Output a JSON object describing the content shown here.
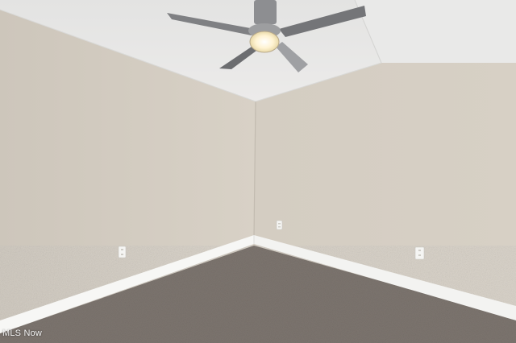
{
  "watermark": {
    "text": "MLS Now"
  },
  "colors": {
    "left_wall": "#d2cbc0",
    "right_wall": "#d6cfc4",
    "ceiling": "#e6e6e4",
    "carpet": "#7e7670",
    "baseboard": "#f7f7f5",
    "fan_blade": "#7f8083",
    "fan_light": "#fff6dc"
  },
  "objects": [
    "ceiling-fan",
    "wall-outlet",
    "wall-outlet",
    "wall-outlet",
    "baseboard",
    "carpet-floor"
  ]
}
